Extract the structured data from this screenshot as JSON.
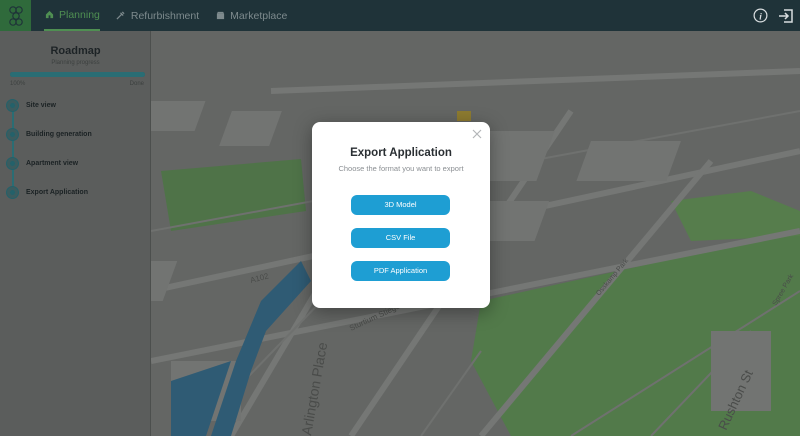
{
  "nav": {
    "items": [
      {
        "label": "Planning",
        "icon": "home-icon",
        "active": true
      },
      {
        "label": "Refurbishment",
        "icon": "tools-icon",
        "active": false
      },
      {
        "label": "Marketplace",
        "icon": "shop-icon",
        "active": false
      }
    ]
  },
  "sidebar": {
    "title": "Roadmap",
    "subtitle": "Planning progress",
    "progress_percent": 100,
    "progress_label": "100%",
    "done_label": "Done",
    "steps": [
      {
        "label": "Site view"
      },
      {
        "label": "Building generation"
      },
      {
        "label": "Apartment view"
      },
      {
        "label": "Export Application"
      }
    ]
  },
  "map": {
    "labels": [
      "A102",
      "Sturtium Stiege",
      "Osskamp Park",
      "Spree Park",
      "Rushton St",
      "Arlington Place"
    ]
  },
  "modal": {
    "title": "Export Application",
    "subtitle": "Choose the format you want to export",
    "buttons": [
      {
        "label": "3D Model"
      },
      {
        "label": "CSV File"
      },
      {
        "label": "PDF Application"
      }
    ]
  },
  "colors": {
    "topbar": "#1f3339",
    "accent_green": "#4f8f52",
    "button_blue": "#1e9ed3",
    "progress": "#2a6d74"
  }
}
